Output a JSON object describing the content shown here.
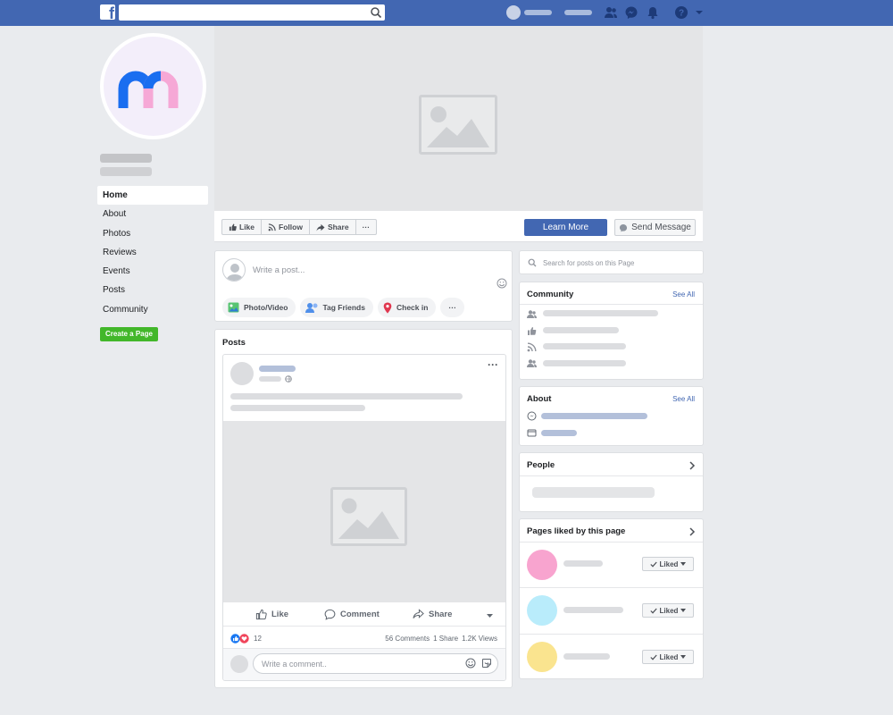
{
  "nav": {
    "items": [
      "Home",
      "About",
      "Photos",
      "Reviews",
      "Events",
      "Posts",
      "Community"
    ],
    "create_page": "Create a Page"
  },
  "actions": {
    "like": "Like",
    "follow": "Follow",
    "share": "Share",
    "more": "···",
    "learn_more": "Learn More",
    "send_message": "Send Message"
  },
  "composer": {
    "placeholder": "Write a post...",
    "photo_video": "Photo/Video",
    "tag_friends": "Tag Friends",
    "check_in": "Check in",
    "more": "···"
  },
  "posts": {
    "title": "Posts",
    "more": "···",
    "like": "Like",
    "comment": "Comment",
    "share": "Share",
    "reaction_count": "12",
    "comments": "56 Comments",
    "shares": "1 Share",
    "views": "1.2K Views",
    "comment_placeholder": "Write a comment.."
  },
  "sidebar": {
    "search_placeholder": "Search for posts on this Page",
    "community_title": "Community",
    "about_title": "About",
    "see_all": "See All",
    "people_title": "People",
    "pages_liked_title": "Pages liked by this page",
    "liked_label": "Liked",
    "liked_pages_colors": [
      "#f8a4cf",
      "#b9ecfb",
      "#fae48f"
    ]
  },
  "colors": {
    "brand": "#4267b2",
    "create_green": "#42b72a"
  }
}
